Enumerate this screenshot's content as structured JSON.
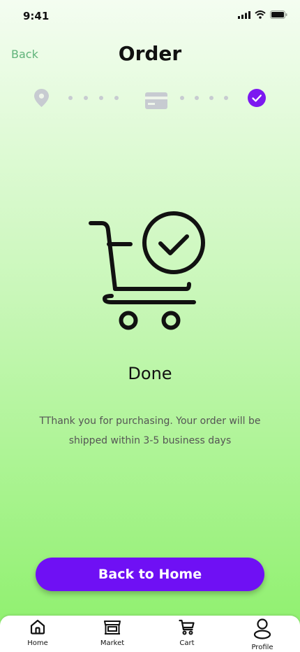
{
  "status_bar": {
    "time": "9:41"
  },
  "header": {
    "back_label": "Back",
    "title": "Order"
  },
  "stepper": {
    "steps": [
      "location-icon",
      "card-icon",
      "check-icon"
    ],
    "active_color": "#7c18f0",
    "inactive_color": "#c7cbd1"
  },
  "content": {
    "title": "Done",
    "message": "TThank you for purchasing. Your order will be shipped within 3-5 business days"
  },
  "cta": {
    "label": "Back to Home",
    "color": "#6f10f4"
  },
  "bottom_nav": {
    "items": [
      {
        "label": "Home",
        "icon": "home-icon"
      },
      {
        "label": "Market",
        "icon": "market-icon"
      },
      {
        "label": "Cart",
        "icon": "cart-icon"
      },
      {
        "label": "Profile",
        "icon": "profile-icon"
      }
    ]
  }
}
